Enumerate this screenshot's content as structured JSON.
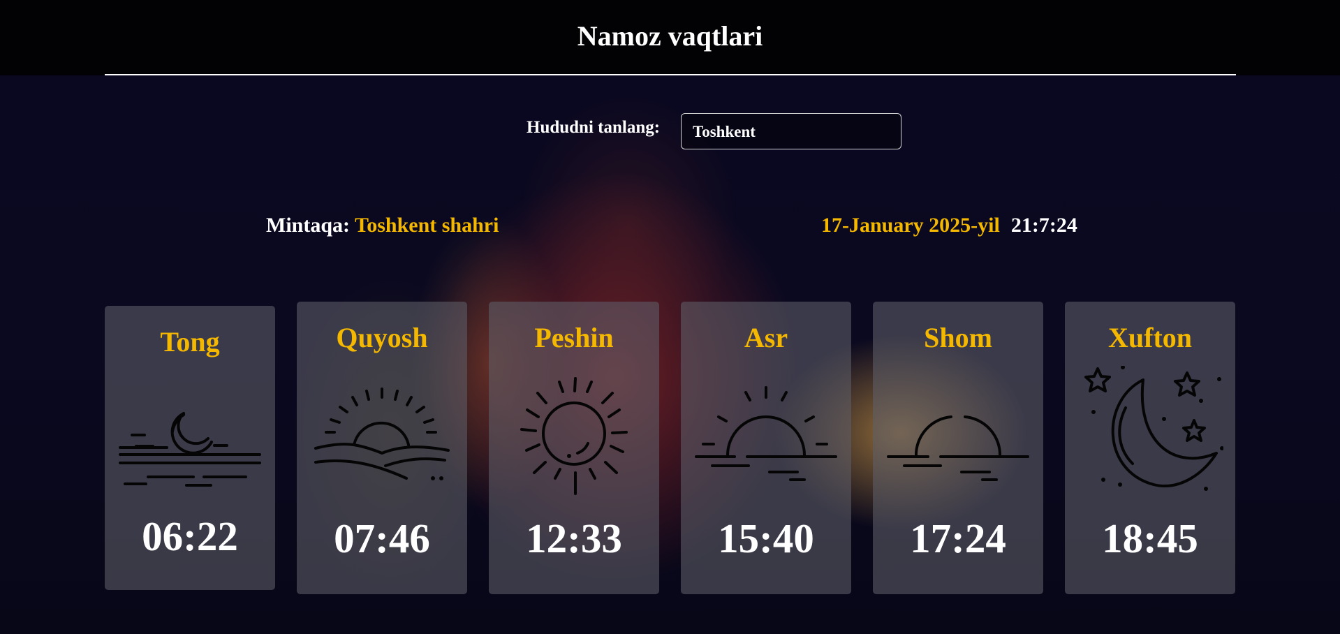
{
  "header": {
    "title": "Namoz vaqtlari"
  },
  "region": {
    "label": "Hududni tanlang:",
    "selected": "Toshkent"
  },
  "info": {
    "region_label": "Mintaqa:",
    "region_name": "Toshkent shahri",
    "date": "17-January 2025-yil",
    "time": "21:7:24"
  },
  "prayers": [
    {
      "name": "Tong",
      "time": "06:22",
      "icon": "moon-horizon-icon"
    },
    {
      "name": "Quyosh",
      "time": "07:46",
      "icon": "sunrise-icon"
    },
    {
      "name": "Peshin",
      "time": "12:33",
      "icon": "sun-icon"
    },
    {
      "name": "Asr",
      "time": "15:40",
      "icon": "sun-horizon-icon"
    },
    {
      "name": "Shom",
      "time": "17:24",
      "icon": "sunset-icon"
    },
    {
      "name": "Xufton",
      "time": "18:45",
      "icon": "moon-stars-icon"
    }
  ],
  "colors": {
    "accent": "#f5b800",
    "text": "#ffffff",
    "header_bg": "#020204"
  }
}
